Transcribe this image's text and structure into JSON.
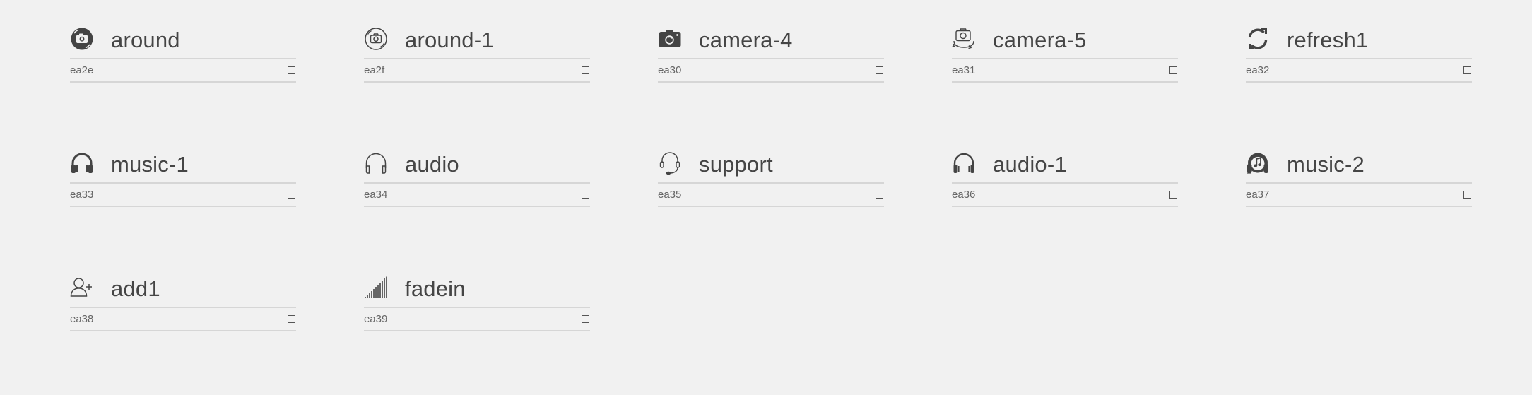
{
  "glyphs": [
    {
      "name": "around",
      "code": "ea2e",
      "icon": "around-icon"
    },
    {
      "name": "around-1",
      "code": "ea2f",
      "icon": "around-1-icon"
    },
    {
      "name": "camera-4",
      "code": "ea30",
      "icon": "camera-4-icon"
    },
    {
      "name": "camera-5",
      "code": "ea31",
      "icon": "camera-5-icon"
    },
    {
      "name": "refresh1",
      "code": "ea32",
      "icon": "refresh1-icon"
    },
    {
      "name": "music-1",
      "code": "ea33",
      "icon": "music-1-icon"
    },
    {
      "name": "audio",
      "code": "ea34",
      "icon": "audio-icon"
    },
    {
      "name": "support",
      "code": "ea35",
      "icon": "support-icon"
    },
    {
      "name": "audio-1",
      "code": "ea36",
      "icon": "audio-1-icon"
    },
    {
      "name": "music-2",
      "code": "ea37",
      "icon": "music-2-icon"
    },
    {
      "name": "add1",
      "code": "ea38",
      "icon": "add1-icon"
    },
    {
      "name": "fadein",
      "code": "ea39",
      "icon": "fadein-icon"
    }
  ]
}
